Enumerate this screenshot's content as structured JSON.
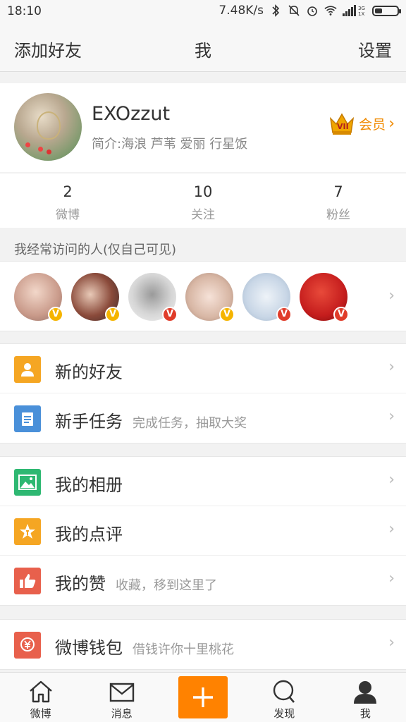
{
  "status": {
    "time": "18:10",
    "speed": "7.48K/s",
    "network": "3G 1X"
  },
  "nav": {
    "left": "添加好友",
    "title": "我",
    "right": "设置"
  },
  "profile": {
    "username": "EXOzzut",
    "intro": "简介:海浪 芦苇 爱丽 行星饭",
    "vip_label": "会员"
  },
  "stats": [
    {
      "num": "2",
      "label": "微博"
    },
    {
      "num": "10",
      "label": "关注"
    },
    {
      "num": "7",
      "label": "粉丝"
    }
  ],
  "visitors_title": "我经常访问的人(仅自己可见)",
  "visitors": [
    {
      "badge": "V",
      "badge_color": "#f5b400",
      "pic_color": "#d9b9a8"
    },
    {
      "badge": "V",
      "badge_color": "#f5b400",
      "pic_color": "#8a4a3a"
    },
    {
      "badge": "V",
      "badge_color": "#e03c2a",
      "pic_color": "#cfcfcf"
    },
    {
      "badge": "V",
      "badge_color": "#f5b400",
      "pic_color": "#d8b7a5"
    },
    {
      "badge": "V",
      "badge_color": "#e03c2a",
      "pic_color": "#c8d6e6"
    },
    {
      "badge": "V",
      "badge_color": "#e03c2a",
      "pic_color": "#c51d1d"
    }
  ],
  "menu": {
    "group1": [
      {
        "label": "新的好友",
        "sub": "",
        "icon": "person-icon",
        "color": "#f5a623"
      },
      {
        "label": "新手任务",
        "sub": "完成任务，抽取大奖",
        "icon": "task-icon",
        "color": "#4a90d9"
      }
    ],
    "group2": [
      {
        "label": "我的相册",
        "sub": "",
        "icon": "photo-icon",
        "color": "#2eb872"
      },
      {
        "label": "我的点评",
        "sub": "",
        "icon": "star-icon",
        "color": "#f5a623"
      },
      {
        "label": "我的赞",
        "sub": "收藏，移到这里了",
        "icon": "thumb-icon",
        "color": "#e8604c"
      }
    ],
    "group3": [
      {
        "label": "微博钱包",
        "sub": "借钱许你十里桃花",
        "icon": "wallet-icon",
        "color": "#e8604c"
      }
    ]
  },
  "tabs": [
    {
      "label": "微博",
      "icon": "home-icon"
    },
    {
      "label": "消息",
      "icon": "mail-icon"
    },
    {
      "label": "",
      "icon": "plus-icon"
    },
    {
      "label": "发现",
      "icon": "search-icon"
    },
    {
      "label": "我",
      "icon": "profile-icon"
    }
  ]
}
